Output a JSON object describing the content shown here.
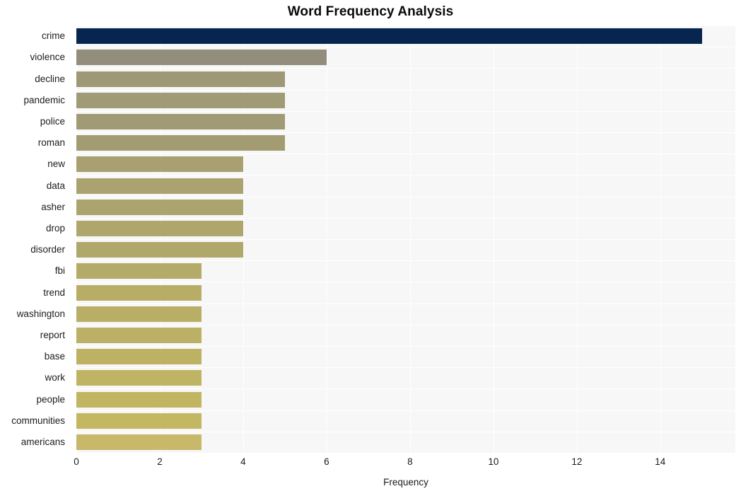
{
  "chart_data": {
    "type": "bar",
    "orientation": "horizontal",
    "title": "Word Frequency Analysis",
    "xlabel": "Frequency",
    "ylabel": "",
    "categories": [
      "crime",
      "violence",
      "decline",
      "pandemic",
      "police",
      "roman",
      "new",
      "data",
      "asher",
      "drop",
      "disorder",
      "fbi",
      "trend",
      "washington",
      "report",
      "base",
      "work",
      "people",
      "communities",
      "americans"
    ],
    "values": [
      15,
      6,
      5,
      5,
      5,
      5,
      4,
      4,
      4,
      4,
      4,
      3,
      3,
      3,
      3,
      3,
      3,
      3,
      3,
      3
    ],
    "bar_colors": [
      "#06264f",
      "#938e7b",
      "#9e9877",
      "#a09a76",
      "#a19b75",
      "#a39c73",
      "#a8a070",
      "#aaa26f",
      "#aca46e",
      "#aea66c",
      "#b0a76b",
      "#b5ab68",
      "#b7ad67",
      "#b9ae66",
      "#bbb065",
      "#bdb264",
      "#bfb463",
      "#c1b562",
      "#c4b761",
      "#c8b869"
    ],
    "xticks": [
      0,
      2,
      4,
      6,
      8,
      10,
      12,
      14
    ],
    "xlim": [
      0,
      15.8
    ],
    "grid": true,
    "legend": false,
    "plot_background": "#f7f7f7",
    "grid_color": "#ffffff",
    "figure_background": "#ffffff"
  }
}
